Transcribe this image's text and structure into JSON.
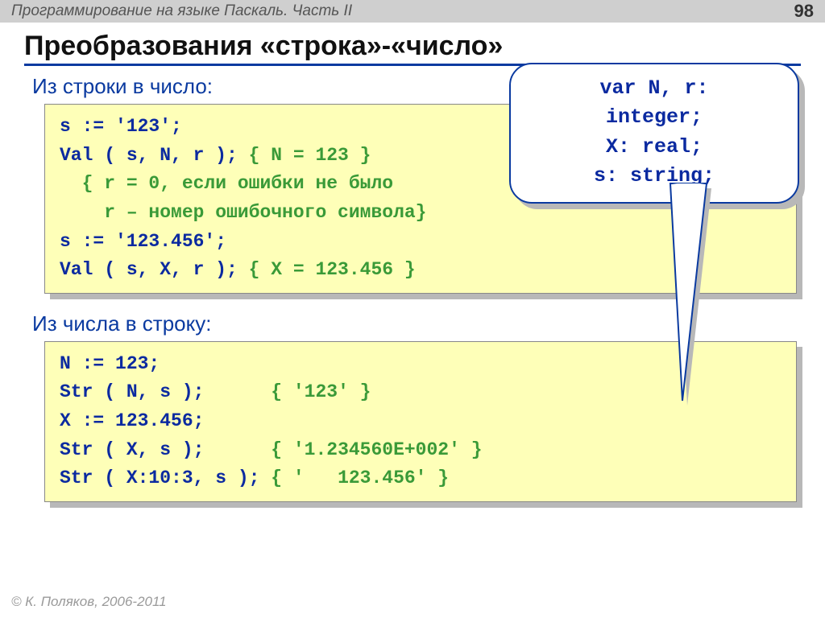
{
  "header": {
    "breadcrumb": "Программирование на языке Паскаль. Часть II",
    "page": "98"
  },
  "title": "Преобразования «строка»-«число»",
  "section1": "Из строки в число:",
  "section2": "Из числа в строку:",
  "decl": {
    "l1": "var N, r:",
    "l2": "integer;",
    "l3": "X: real;",
    "l4": "s: string;"
  },
  "code1": {
    "a": "s := '123';",
    "b1": "Val ( s, N, r ); ",
    "b2": "{ N = 123 }",
    "c": "  { r = 0, если ошибки не было",
    "d": "    r – номер ошибочного символа}",
    "e": "s := '123.456';",
    "f1": "Val ( s, X, r ); ",
    "f2": "{ X = 123.456 }"
  },
  "code2": {
    "a": "N := 123;",
    "b1": "Str ( N, s );      ",
    "b2": "{ '123' }",
    "c": "X := 123.456;",
    "d1": "Str ( X, s );      ",
    "d2": "{ '1.234560E+002' }",
    "e1": "Str ( X:10:3, s ); ",
    "e2": "{ '   123.456' }"
  },
  "footer": "© К. Поляков, 2006-2011"
}
